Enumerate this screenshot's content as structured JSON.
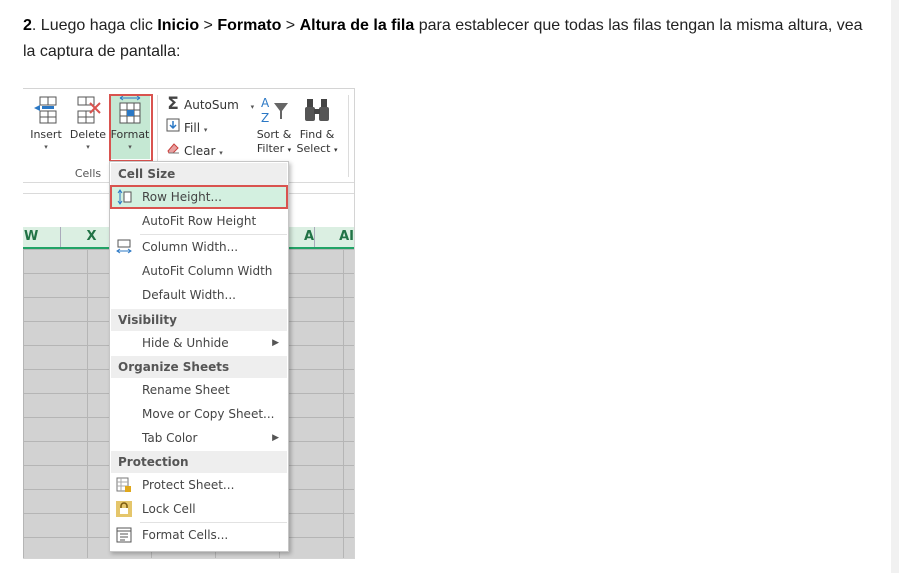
{
  "article": {
    "step_number": "2",
    "text_1": ". Luego haga clic ",
    "bold_1": "Inicio",
    "text_2": " > ",
    "bold_2": "Formato",
    "text_3": " > ",
    "bold_3": "Altura de la fila",
    "text_4": " para establecer que todas las filas tengan la misma altura, vea la captura de pantalla:"
  },
  "ribbon": {
    "insert_label": "Insert",
    "delete_label": "Delete",
    "format_label": "Format",
    "cells_group_label": "Cells",
    "autosum_label": "AutoSum",
    "fill_label": "Fill",
    "clear_label": "Clear",
    "sort_filter_line1": "Sort &",
    "sort_filter_line2": "Filter",
    "find_select_line1": "Find &",
    "find_select_line2": "Select",
    "dropdown_glyph": "▾"
  },
  "grid": {
    "columns": [
      "W",
      "X",
      "A",
      "AI"
    ]
  },
  "menu": {
    "sections": {
      "cell_size": "Cell Size",
      "visibility": "Visibility",
      "organize": "Organize Sheets",
      "protection": "Protection"
    },
    "items": {
      "row_height": "Row Height...",
      "autofit_row_height": "AutoFit Row Height",
      "column_width": "Column Width...",
      "autofit_column_width": "AutoFit Column Width",
      "default_width": "Default Width...",
      "hide_unhide": "Hide & Unhide",
      "rename_sheet": "Rename Sheet",
      "move_copy_sheet": "Move or Copy Sheet...",
      "tab_color": "Tab Color",
      "protect_sheet": "Protect Sheet...",
      "lock_cell": "Lock Cell",
      "format_cells": "Format Cells..."
    },
    "submenu_glyph": "▶"
  },
  "colors": {
    "accent_green": "#217346",
    "highlight_red": "#d9534f",
    "highlight_fill": "#d3f0e0"
  }
}
